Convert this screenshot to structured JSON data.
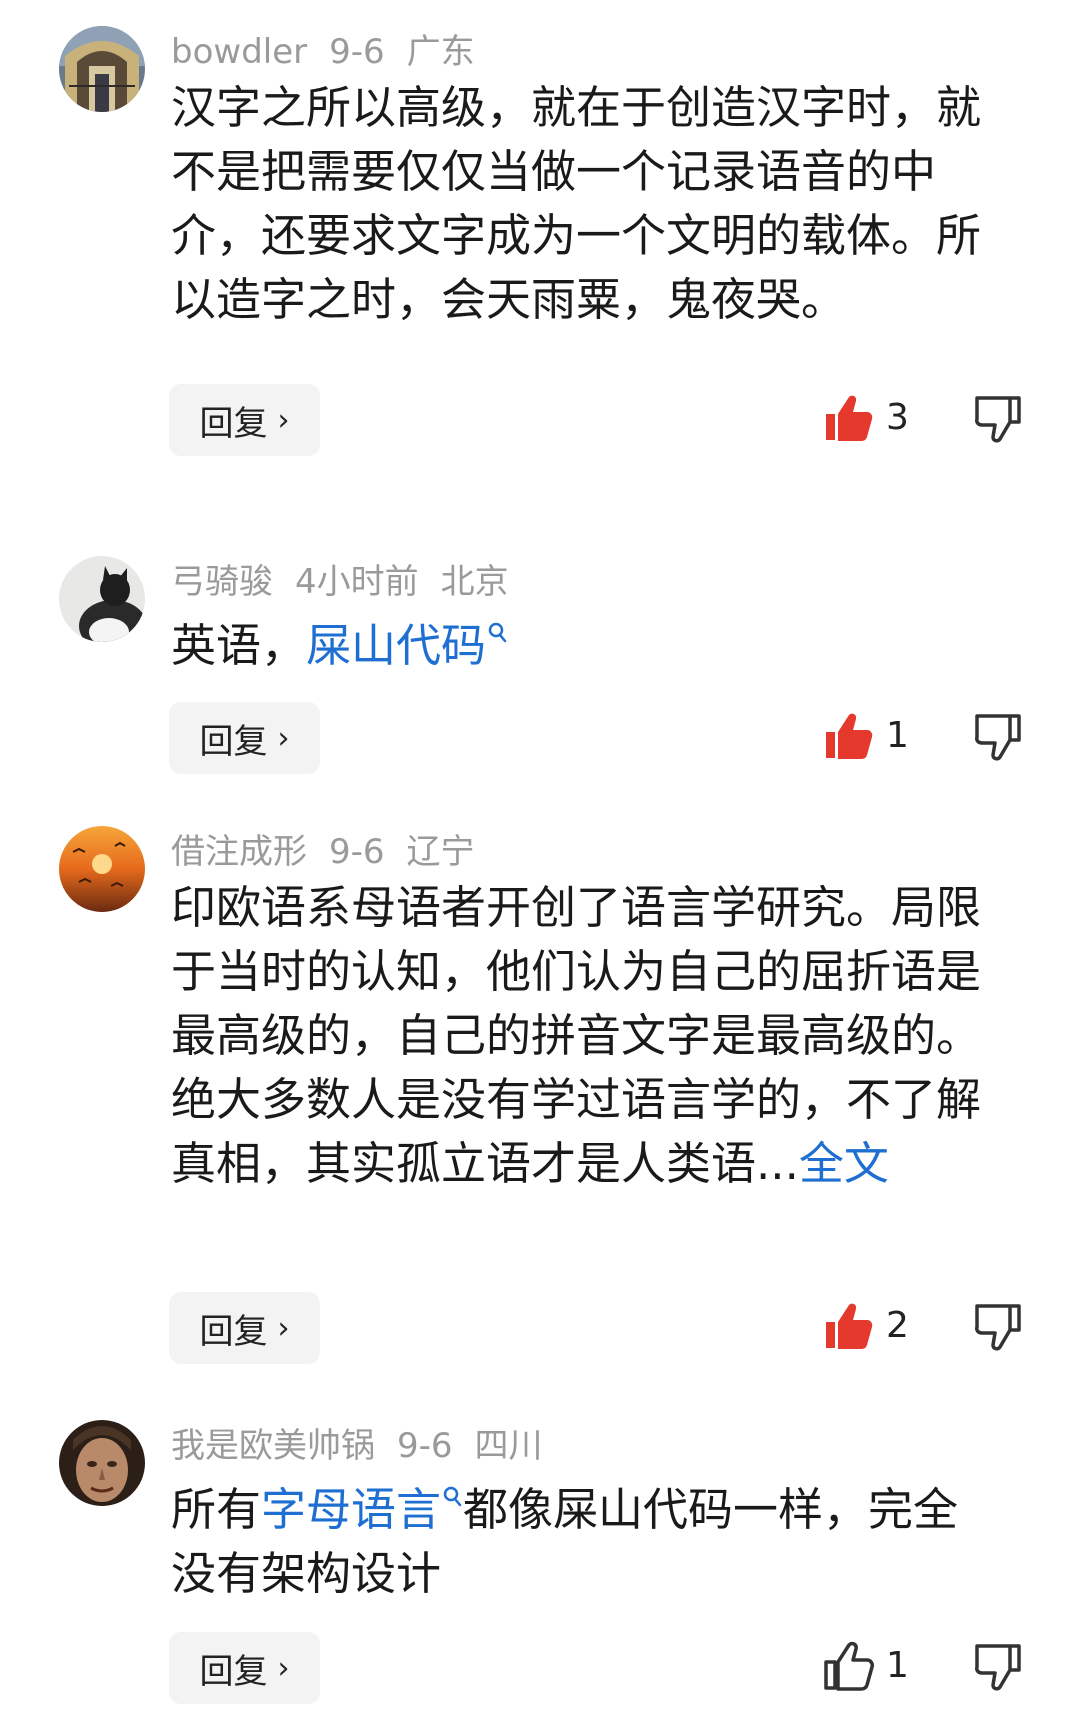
{
  "reply_label": "回复",
  "colors": {
    "like_active": "#e5392d",
    "link": "#1e6fd1",
    "meta": "#9a9a9a"
  },
  "comments": [
    {
      "username": "bowdler",
      "time": "9-6",
      "location": "广东",
      "text": "汉字之所以高级，就在于创造汉字时，就不是把需要仅仅当做一个记录语音的中介，还要求文字成为一个文明的载体。所以造字之时，会天雨粟，鬼夜哭。",
      "likes": "3",
      "liked": true
    },
    {
      "username": "弓骑骏",
      "time": "4小时前",
      "location": "北京",
      "text_before": "英语，",
      "link_text": "屎山代码",
      "likes": "1",
      "liked": true
    },
    {
      "username": "借注成形",
      "time": "9-6",
      "location": "辽宁",
      "text_p1": "印欧语系母语者开创了语言学研究。局限于当时的认知，他们认为自己的屈折语是最高级的，自己的拼音文字是最高级的。",
      "text_p2": "绝大多数人是没有学过语言学的，不了解真相，其实孤立语才是人类语...",
      "more_link": "全文",
      "likes": "2",
      "liked": true
    },
    {
      "username": "我是欧美帅锅",
      "time": "9-6",
      "location": "四川",
      "text_before": "所有",
      "link_text": "字母语言",
      "text_after": "都像屎山代码一样，完全没有架构设计",
      "likes": "1",
      "liked": false
    }
  ]
}
